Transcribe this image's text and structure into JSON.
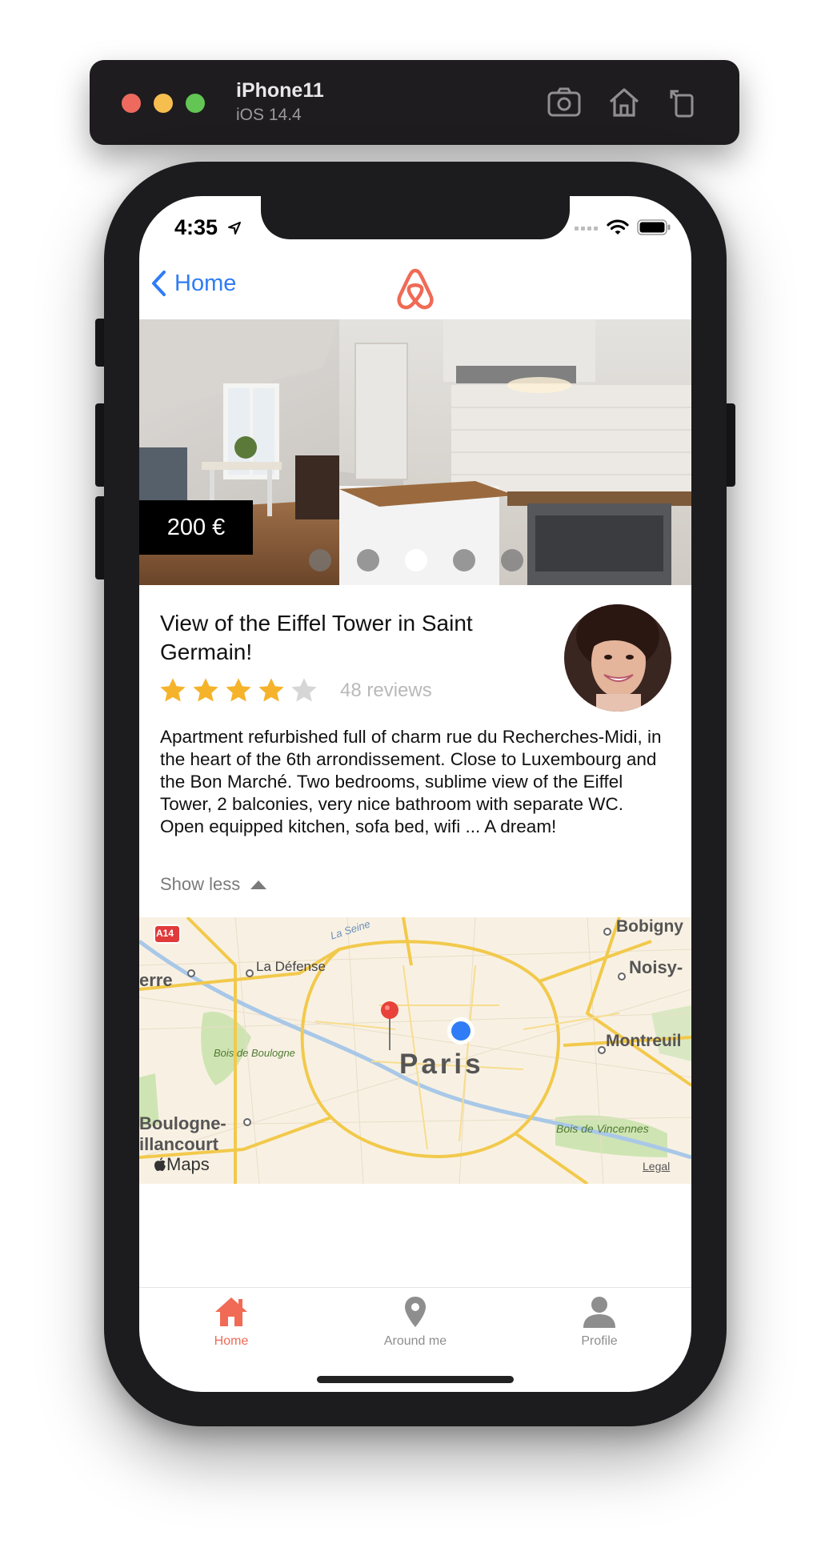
{
  "simulator": {
    "device_name": "iPhone11",
    "os_version": "iOS 14.4",
    "icons": [
      "screenshot-icon",
      "home-icon",
      "rotate-icon"
    ]
  },
  "status_bar": {
    "time": "4:35",
    "icons": [
      "location-arrow-icon",
      "signal-icon",
      "wifi-icon",
      "battery-icon"
    ]
  },
  "nav": {
    "back_label": "Home",
    "logo": "airbnb-logo-icon",
    "brand_color": "#f06a55",
    "link_color": "#2f7cf6"
  },
  "listing": {
    "price": "200 €",
    "carousel": {
      "count": 5,
      "active_index": 2
    },
    "title": "View of the Eiffel Tower in Saint Germain!",
    "rating": 4,
    "rating_max": 5,
    "reviews": "48 reviews",
    "description": "Apartment refurbished full of charm rue du Recherches-Midi, in the heart of the 6th arrondissement. Close to Luxembourg and the Bon Marché. Two bedrooms, sublime view of the Eiffel Tower, 2 balconies, very nice bathroom with separate WC. Open equipped kitchen, sofa bed, wifi ... A dream!",
    "show_less": "Show less"
  },
  "map": {
    "labels": {
      "a14": "A14",
      "seine": "La Seine",
      "la_defense": "La Défense",
      "nanterre": "erre",
      "bobigny": "Bobigny",
      "noisy": "Noisy-",
      "bois_boulogne": "Bois de Boulogne",
      "paris": "Paris",
      "montreuil": "Montreuil",
      "boulogne_1": "Boulogne-",
      "boulogne_2": "illancourt",
      "bois_vincennes": "Bois de Vincennes",
      "maps": "Maps",
      "legal": "Legal"
    }
  },
  "tabs": [
    {
      "label": "Home",
      "icon": "home-icon",
      "active": true
    },
    {
      "label": "Around me",
      "icon": "map-pin-icon",
      "active": false
    },
    {
      "label": "Profile",
      "icon": "user-icon",
      "active": false
    }
  ]
}
